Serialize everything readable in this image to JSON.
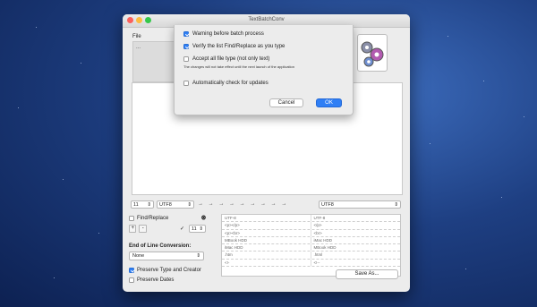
{
  "window": {
    "title": "TextBatchConv"
  },
  "file_panel": {
    "label": "File",
    "dots": "..."
  },
  "encoding_row": {
    "left_count": "11",
    "source_encoding": "UTF8",
    "arrows": "→ → → → → → → → →",
    "target_encoding": "UTF8"
  },
  "options": {
    "find_replace_label": "Find/Replace",
    "plus": "+",
    "minus": "-",
    "check_mark": "✓",
    "find_count": "11",
    "eol_label": "End of Line Conversion:",
    "eol_value": "None",
    "preserve_type_label": "Preserve Type and Creator",
    "preserve_dates_label": "Preserve Dates",
    "save_as_label": "Save As..."
  },
  "table_rows": [
    [
      "UTF-8",
      "UTF-8"
    ],
    [
      "<p></p>",
      "</p>"
    ],
    [
      "<p><br>",
      "<br>"
    ],
    [
      "MBook HDD",
      "iMac HDD"
    ],
    [
      "iMac HDD",
      "MBook HDD"
    ],
    [
      ".htm",
      ".html"
    ],
    [
      "<!-",
      "<!--"
    ]
  ],
  "preferences_sheet": {
    "warning_label": "Warning before batch process",
    "verify_label": "Verify the list Find/Replace as you type",
    "accept_label": "Accept all file type (not only text)",
    "note": "The changes will not take effect until the next launch of the application",
    "auto_update_label": "Automatically check for updates",
    "cancel_label": "Cancel",
    "ok_label": "OK"
  },
  "colors": {
    "accent": "#2f7ff5",
    "desktop": "#1e3f82"
  }
}
